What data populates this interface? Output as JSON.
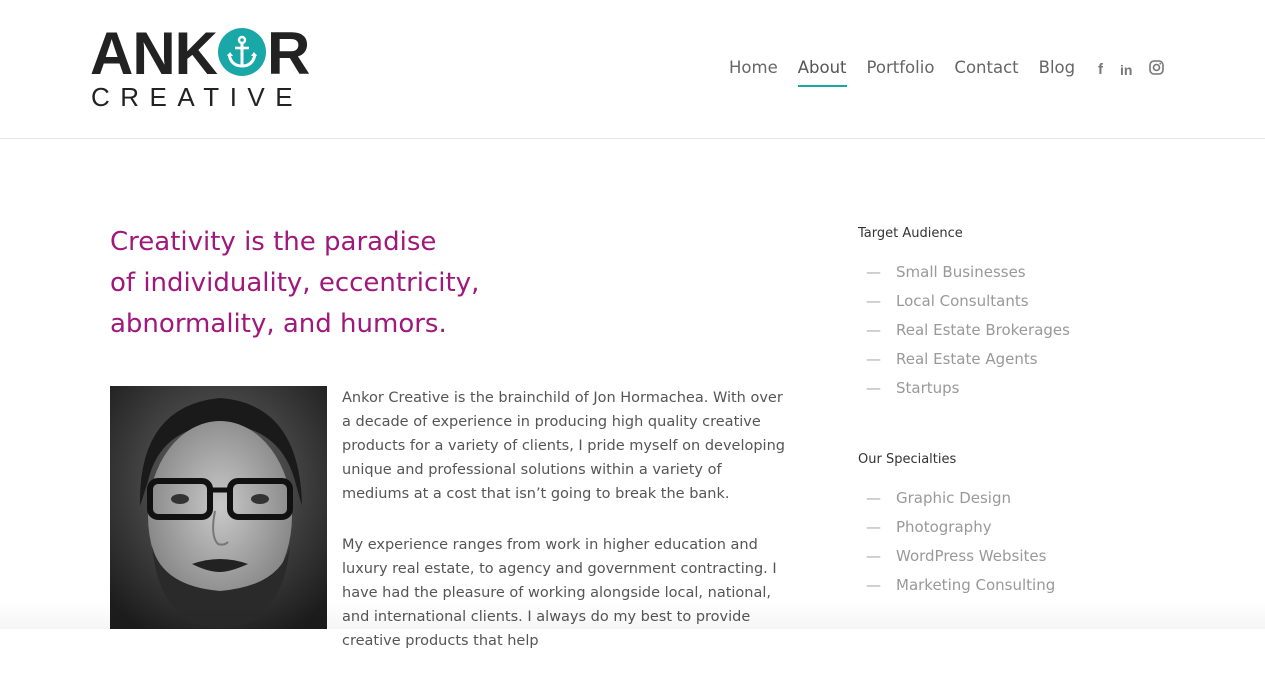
{
  "header": {
    "logo": {
      "top_left": "ANK",
      "top_right": "R",
      "bottom": "CREATIVE",
      "accent_color": "#1aa7a7"
    },
    "nav": [
      {
        "label": "Home",
        "active": false
      },
      {
        "label": "About",
        "active": true
      },
      {
        "label": "Portfolio",
        "active": false
      },
      {
        "label": "Contact",
        "active": false
      },
      {
        "label": "Blog",
        "active": false
      }
    ],
    "social": {
      "facebook": "f",
      "linkedin": "in",
      "instagram": "instagram-icon"
    }
  },
  "main": {
    "quote_lines": [
      "Creativity is the paradise",
      "of individuality, eccentricity,",
      "abnormality, and humors."
    ],
    "quote_color": "#a0187b",
    "bio": [
      "Ankor Creative is the brainchild of Jon Hormachea. With over a decade of experience in producing high quality creative products for a variety of clients, I pride myself on developing unique and professional solutions within a variety of mediums at a cost that isn’t going to break the bank.",
      "My experience ranges from work in higher education and luxury real estate, to agency and government contracting. I have had the pleasure of working alongside local, national, and international clients. I always do my best to provide creative products that help"
    ]
  },
  "sidebar": {
    "target": {
      "title": "Target Audience",
      "items": [
        "Small Businesses",
        "Local Consultants",
        "Real Estate Brokerages",
        "Real Estate Agents",
        "Startups"
      ]
    },
    "specialties": {
      "title": "Our Specialties",
      "items": [
        "Graphic Design",
        "Photography",
        "WordPress Websites",
        "Marketing Consulting"
      ]
    },
    "dash": "—"
  }
}
